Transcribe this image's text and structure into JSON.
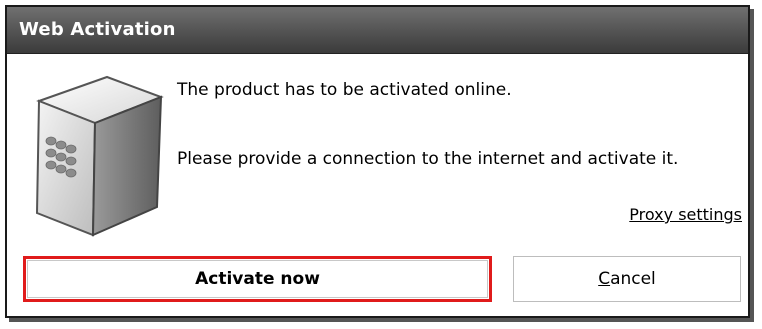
{
  "window": {
    "title": "Web Activation"
  },
  "message": {
    "line1": "The product has to be activated online.",
    "line2": "Please provide a connection to the internet and activate it."
  },
  "links": {
    "proxy_settings": "Proxy settings"
  },
  "buttons": {
    "activate_label": "Activate now",
    "cancel_label_mnemonic": "C",
    "cancel_label_rest": "ancel"
  },
  "icons": {
    "device": "server-box-icon"
  },
  "colors": {
    "titlebar": "#555555",
    "highlight": "#e01b1b"
  }
}
